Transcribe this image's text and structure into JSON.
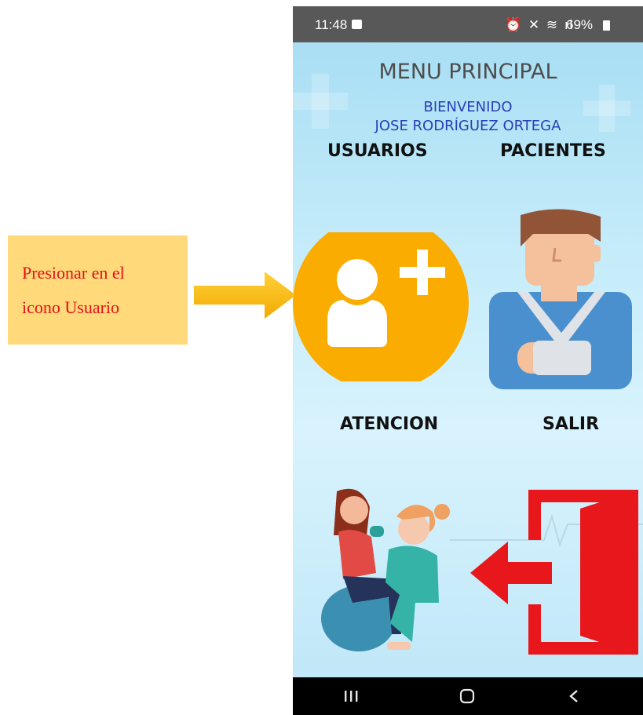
{
  "callout": {
    "line1": "Presionar en el",
    "line2": "icono Usuario",
    "color": "#ffd97a",
    "text_color": "#e0101a"
  },
  "status_bar": {
    "time": "11:48",
    "battery": "69%"
  },
  "screen": {
    "title": "MENU PRINCIPAL",
    "welcome": "BIENVENIDO",
    "user_name": "JOSE RODRÍGUEZ ORTEGA"
  },
  "menu": {
    "usuarios": "USUARIOS",
    "pacientes": "PACIENTES",
    "atencion": "ATENCION",
    "salir": "SALIR"
  },
  "icons": {
    "usuarios": "add-user-icon",
    "pacientes": "patient-icon",
    "atencion": "therapy-icon",
    "salir": "exit-door-icon"
  },
  "colors": {
    "usuarios_icon": "#fbac00",
    "salir_icon": "#e8171c",
    "title": "#4d4d4d",
    "welcome": "#2a3fb5"
  }
}
